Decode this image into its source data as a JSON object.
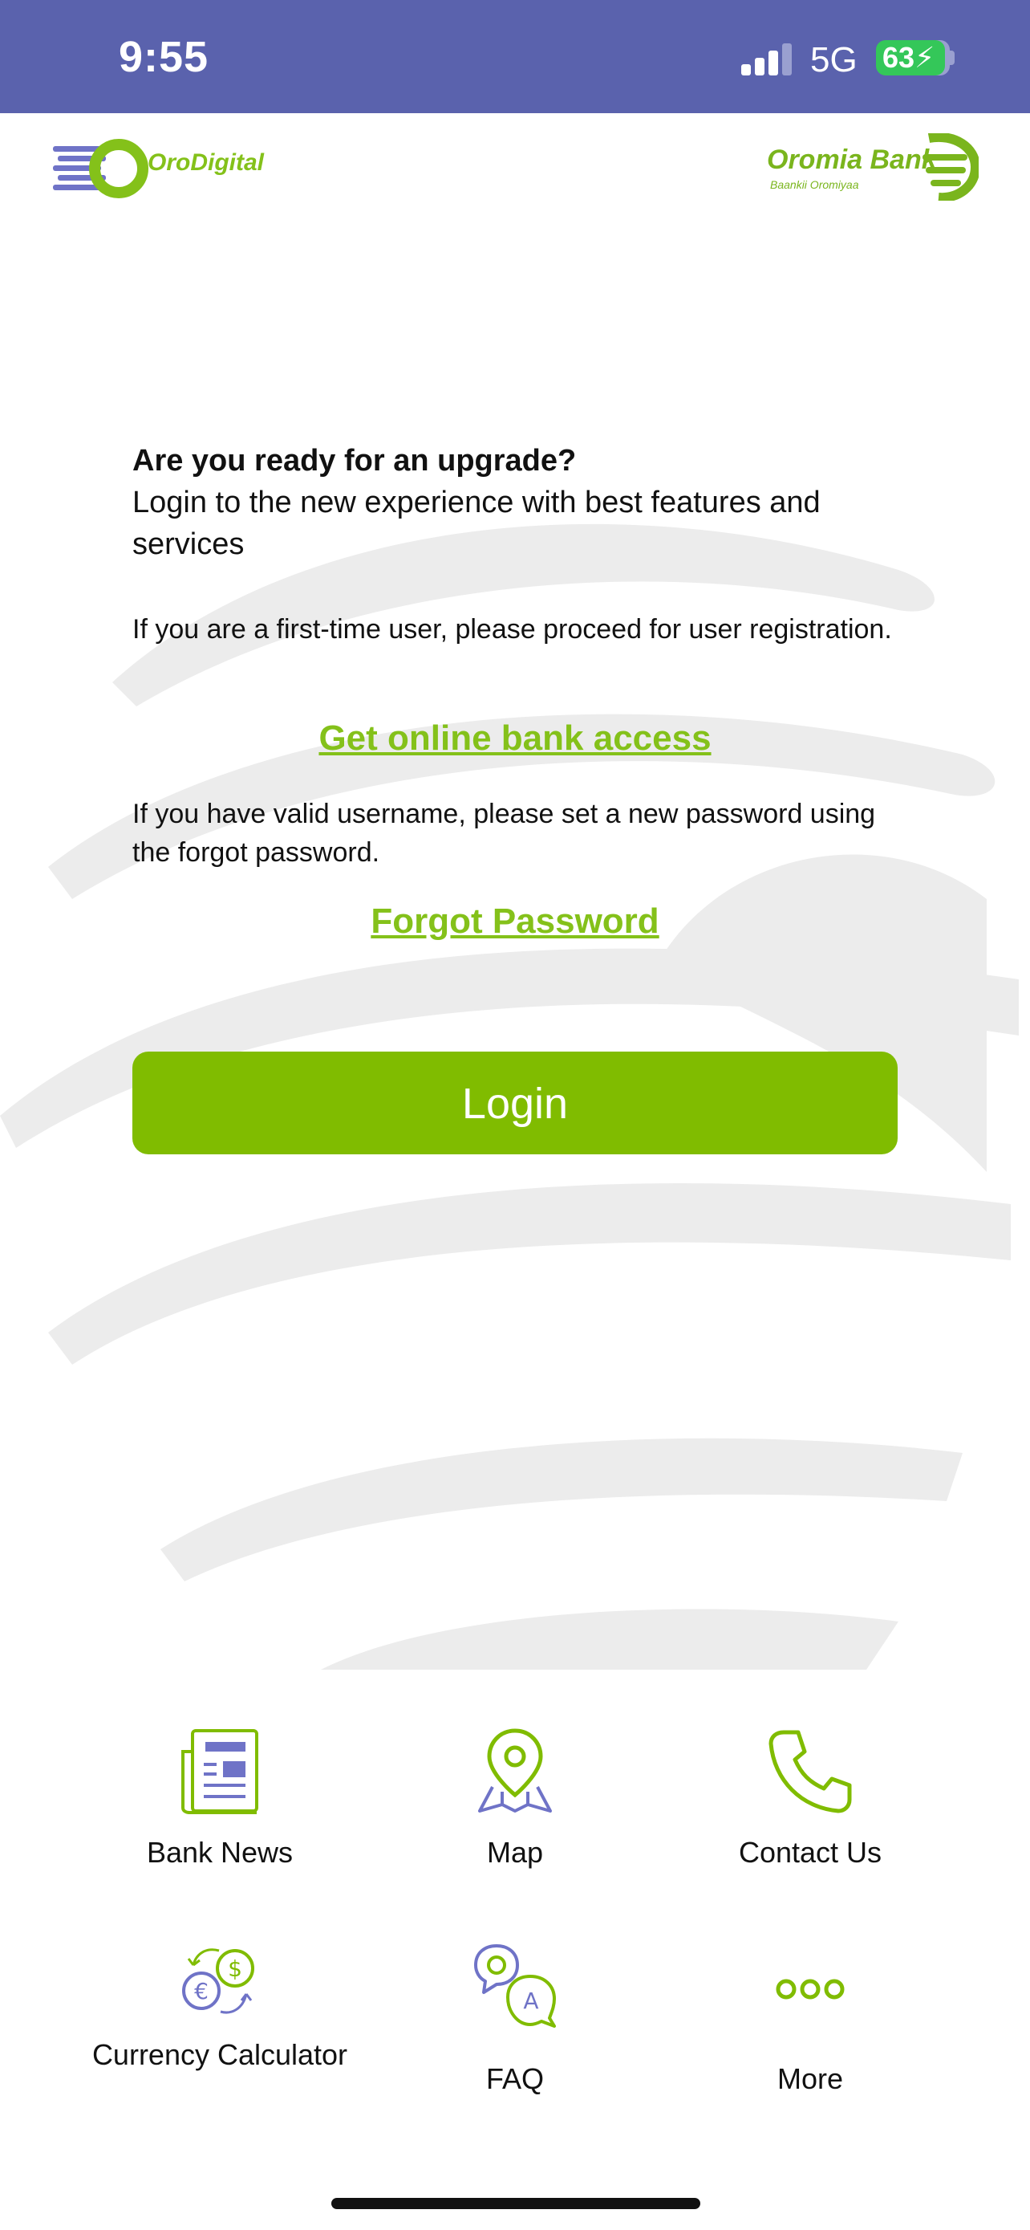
{
  "status_bar": {
    "time": "9:55",
    "network": "5G",
    "battery": "63"
  },
  "header": {
    "left_logo_text": "OroDigital",
    "right_logo_text": "Oromia Bank",
    "right_logo_subtext": "Baankii Oromiyaa"
  },
  "main": {
    "upgrade_title": "Are you ready for an upgrade?",
    "upgrade_text": "Login to the new experience with best features and services",
    "first_time_text": "If you are a first-time user, please proceed for user registration.",
    "online_access_link": "Get online bank access",
    "valid_username_text": "If you have valid username, please set a new password using the forgot password.",
    "forgot_password_link": "Forgot Password",
    "login_button": "Login"
  },
  "quick_actions": [
    {
      "label": "Bank News",
      "icon": "newspaper-icon"
    },
    {
      "label": "Map",
      "icon": "map-pin-icon"
    },
    {
      "label": "Contact Us",
      "icon": "phone-icon"
    },
    {
      "label": "Currency Calculator",
      "icon": "currency-exchange-icon"
    },
    {
      "label": "FAQ",
      "icon": "faq-chat-icon"
    },
    {
      "label": "More",
      "icon": "more-dots-icon"
    }
  ],
  "colors": {
    "status_bar": "#5a62ad",
    "brand_green": "#80bc00",
    "brand_purple": "#6f73c7"
  }
}
